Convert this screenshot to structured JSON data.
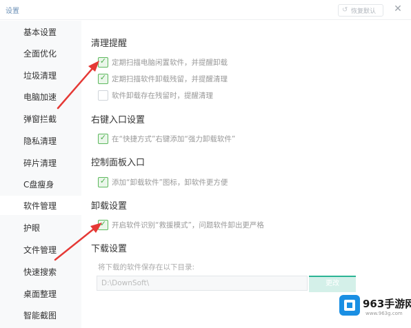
{
  "window": {
    "title": "设置",
    "reset_label": "恢复默认",
    "reset_icon": "undo-icon",
    "close_glyph": "✕"
  },
  "sidebar": {
    "items": [
      {
        "label": "基本设置"
      },
      {
        "label": "全面优化"
      },
      {
        "label": "垃圾清理"
      },
      {
        "label": "电脑加速"
      },
      {
        "label": "弹窗拦截"
      },
      {
        "label": "隐私清理"
      },
      {
        "label": "碎片清理"
      },
      {
        "label": "C盘瘦身"
      },
      {
        "label": "软件管理",
        "active": true
      },
      {
        "label": "护眼"
      },
      {
        "label": "文件管理"
      },
      {
        "label": "快速搜索"
      },
      {
        "label": "桌面整理"
      },
      {
        "label": "智能截图"
      }
    ]
  },
  "sections": {
    "cleanup": {
      "title": "清理提醒",
      "options": [
        {
          "label": "定期扫描电脑闲置软件，并提醒卸载",
          "checked": true
        },
        {
          "label": "定期扫描软件卸载残留，并提醒清理",
          "checked": true
        },
        {
          "label": "软件卸载存在残留时，提醒清理",
          "checked": false
        }
      ]
    },
    "context_menu": {
      "title": "右键入口设置",
      "option": {
        "label": "在“快捷方式”右键添加“强力卸载软件”",
        "checked": true
      }
    },
    "control_panel": {
      "title": "控制面板入口",
      "option": {
        "label": "添加“卸载软件”图标，卸软件更方便",
        "checked": true
      }
    },
    "uninstall": {
      "title": "卸载设置",
      "option": {
        "label": "开启软件识别“救援模式”，问题软件卸出更严格",
        "checked": true
      }
    },
    "download": {
      "title": "下载设置",
      "path_label": "将下载的软件保存在以下目录:",
      "path_value": "D:\\DownSoft\\",
      "browse_label": "更改"
    }
  },
  "watermark": {
    "text": "963手游网",
    "url": "www.963g.com"
  },
  "colors": {
    "accent_green": "#2ab394",
    "check_green": "#4cae4c",
    "arrow_red": "#e53935",
    "title_blue": "#6f93b8"
  }
}
